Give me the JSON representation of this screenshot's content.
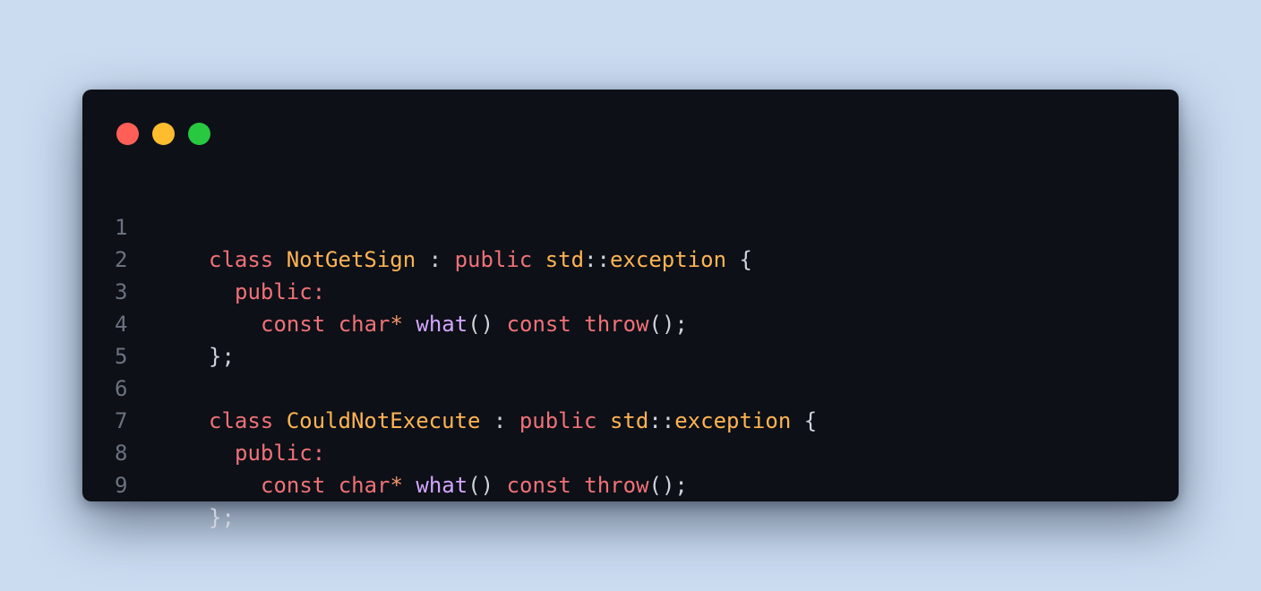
{
  "window": {
    "controls": [
      "close",
      "minimize",
      "maximize"
    ],
    "colors": {
      "background": "#0d1017",
      "page_background": "#cbdcf1",
      "close": "#ff5f57",
      "minimize": "#febc2e",
      "maximize": "#28c840",
      "keyword": "#f07178",
      "class_name": "#ffb454",
      "function": "#d2a6ff",
      "punctuation": "#cfd4dc",
      "line_number": "#6b7280"
    }
  },
  "code": {
    "language": "cpp",
    "lines": [
      {
        "number": "1",
        "tokens": {
          "kw_class": "class",
          "class_name": "NotGetSign",
          "colon": " : ",
          "kw_public": "public",
          "ns": "std",
          "scope": "::",
          "base": "exception",
          "brace": " {"
        }
      },
      {
        "number": "2",
        "tokens": {
          "access": "public:"
        }
      },
      {
        "number": "3",
        "tokens": {
          "kw_const": "const",
          "kw_char": "char",
          "star": "*",
          "fn_what": "what",
          "parens": "()",
          "kw_const2": "const",
          "kw_throw": "throw",
          "end": "();"
        }
      },
      {
        "number": "4",
        "tokens": {
          "close": "};"
        }
      },
      {
        "number": "5",
        "tokens": {}
      },
      {
        "number": "6",
        "tokens": {
          "kw_class": "class",
          "class_name": "CouldNotExecute",
          "colon": " : ",
          "kw_public": "public",
          "ns": "std",
          "scope": "::",
          "base": "exception",
          "brace": " {"
        }
      },
      {
        "number": "7",
        "tokens": {
          "access": "public:"
        }
      },
      {
        "number": "8",
        "tokens": {
          "kw_const": "const",
          "kw_char": "char",
          "star": "*",
          "fn_what": "what",
          "parens": "()",
          "kw_const2": "const",
          "kw_throw": "throw",
          "end": "();"
        }
      },
      {
        "number": "9",
        "tokens": {
          "close": "};"
        }
      }
    ]
  }
}
